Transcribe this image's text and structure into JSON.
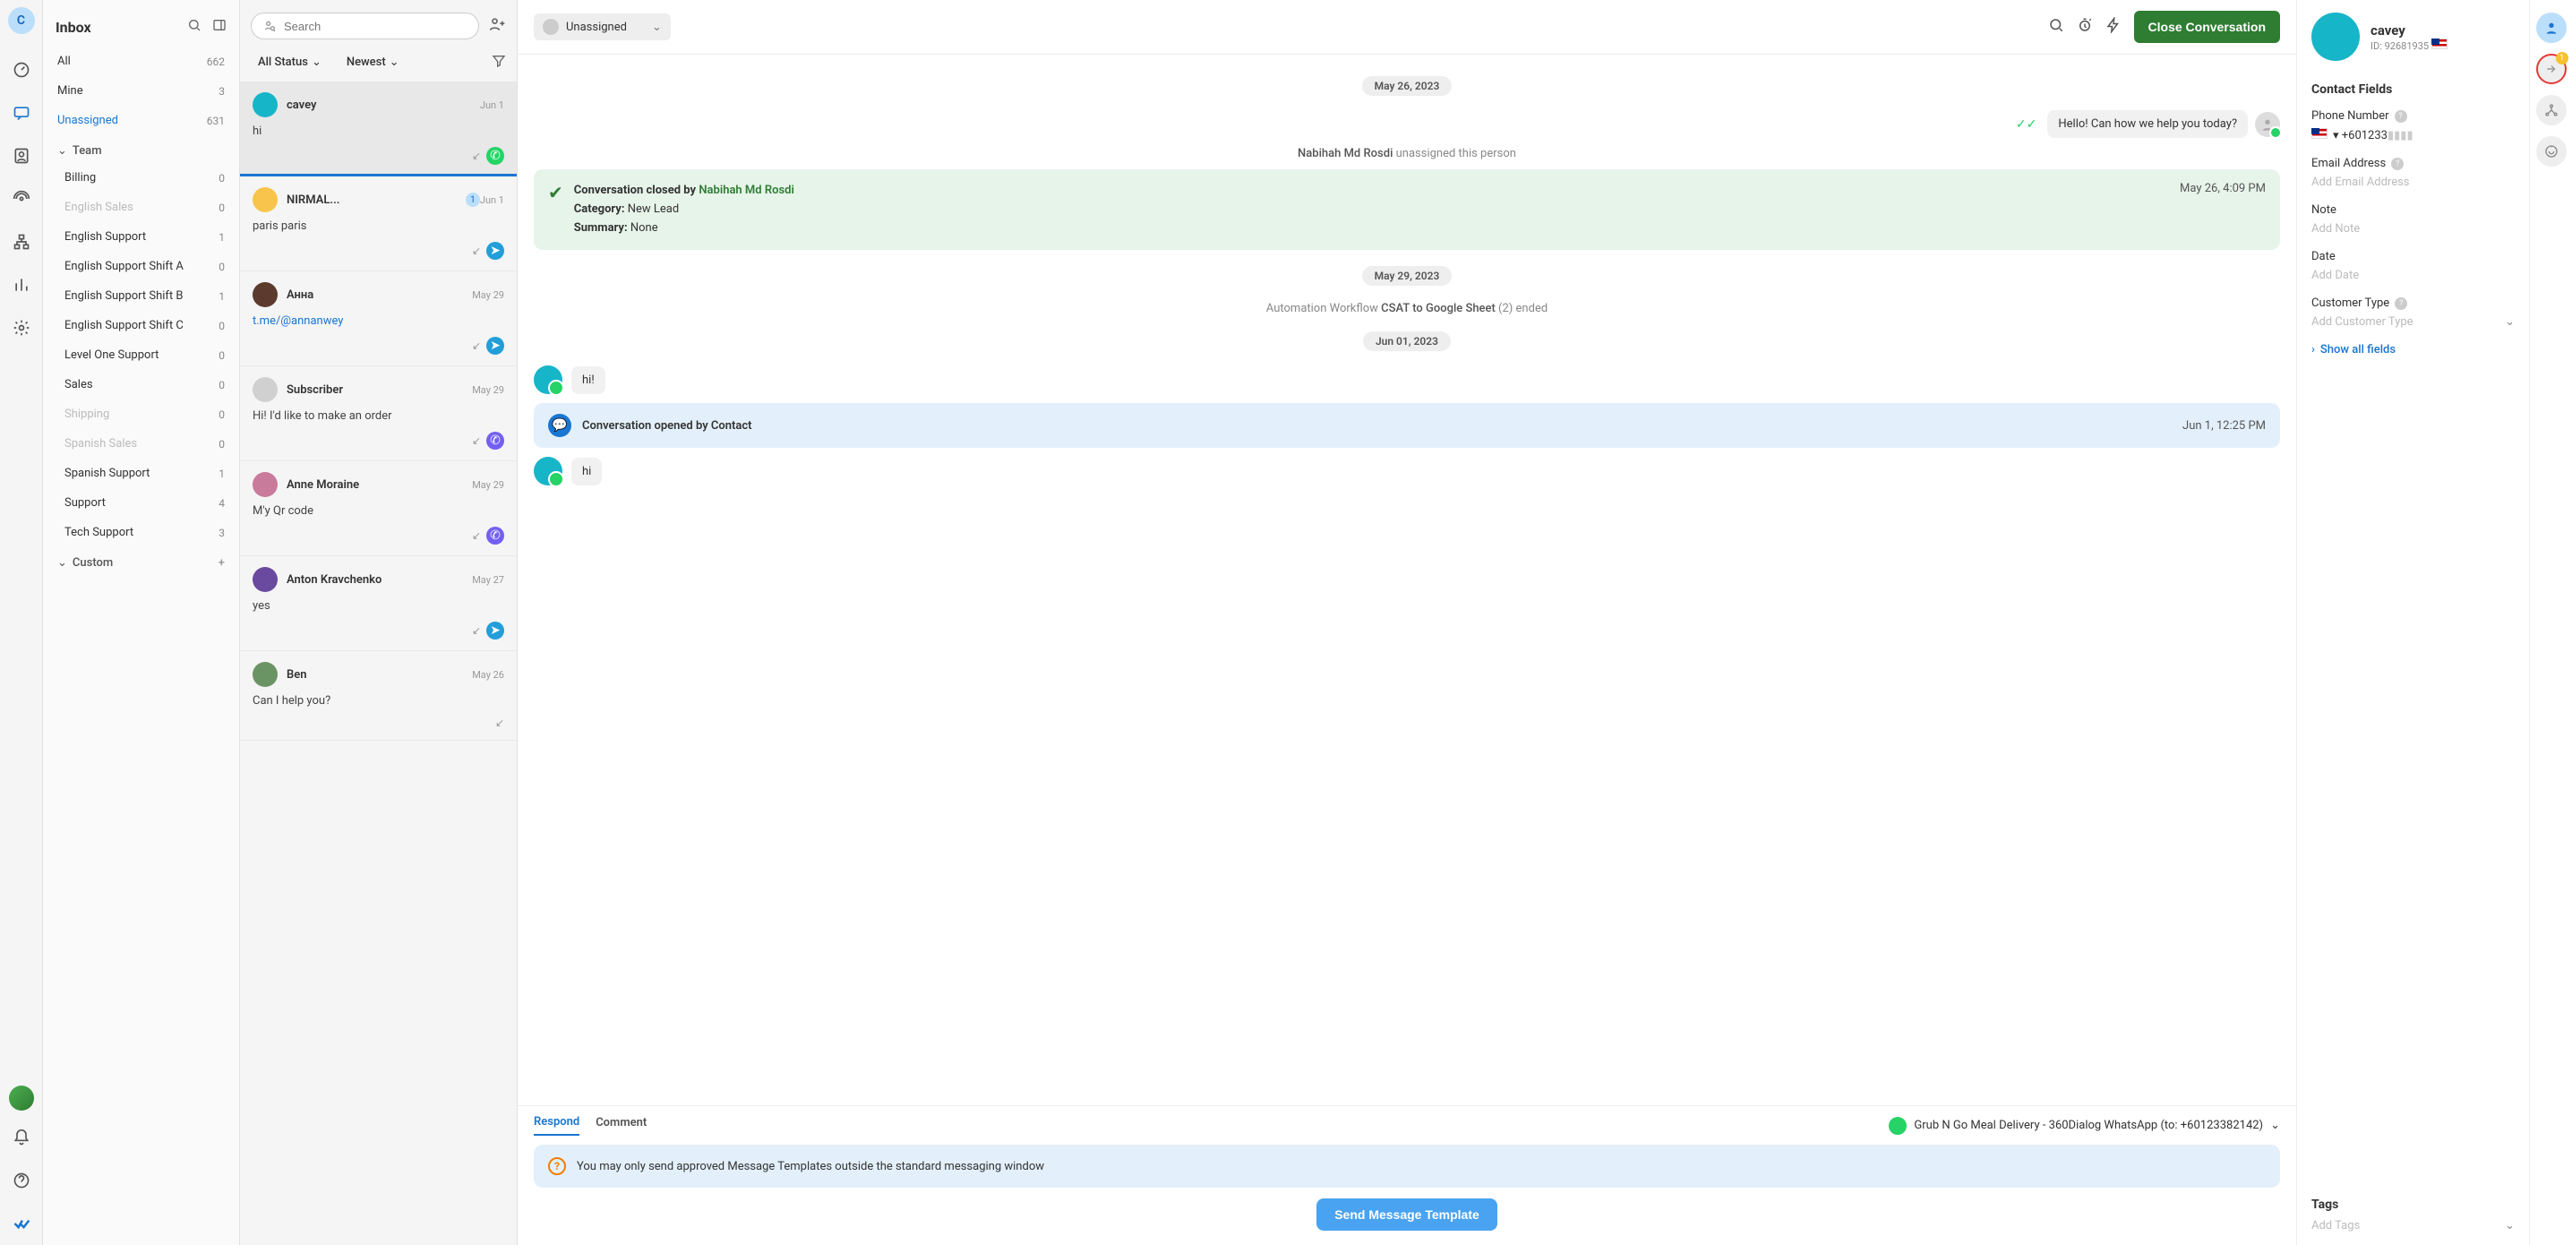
{
  "rail": {
    "avatar_letter": "C"
  },
  "sidebar": {
    "title": "Inbox",
    "items": [
      {
        "label": "All",
        "count": "662",
        "key": "all"
      },
      {
        "label": "Mine",
        "count": "3",
        "key": "mine"
      },
      {
        "label": "Unassigned",
        "count": "631",
        "key": "unassigned",
        "active": true
      }
    ],
    "team_label": "Team",
    "team_items": [
      {
        "label": "Billing",
        "count": "0"
      },
      {
        "label": "English Sales",
        "count": "0",
        "muted": true
      },
      {
        "label": "English Support",
        "count": "1"
      },
      {
        "label": "English Support Shift A",
        "count": "0"
      },
      {
        "label": "English Support Shift B",
        "count": "1"
      },
      {
        "label": "English Support Shift C",
        "count": "0"
      },
      {
        "label": "Level One Support",
        "count": "0"
      },
      {
        "label": "Sales",
        "count": "0"
      },
      {
        "label": "Shipping",
        "count": "0",
        "muted": true
      },
      {
        "label": "Spanish Sales",
        "count": "0",
        "muted": true
      },
      {
        "label": "Spanish Support",
        "count": "1"
      },
      {
        "label": "Support",
        "count": "4"
      },
      {
        "label": "Tech Support",
        "count": "3"
      }
    ],
    "custom_label": "Custom"
  },
  "convlist": {
    "search_placeholder": "Search",
    "filter_status": "All Status",
    "filter_sort": "Newest",
    "items": [
      {
        "name": "cavey",
        "time": "Jun 1",
        "preview": "hi",
        "channel": "whatsapp",
        "selected": true,
        "avatar_bg": "#17b5c8"
      },
      {
        "name": "NIRMAL...",
        "badge": "1",
        "time": "Jun 1",
        "preview": "paris paris",
        "channel": "telegram",
        "avatar_bg": "#f8c44b"
      },
      {
        "name": "Анна",
        "time": "May 29",
        "preview": "t.me/@annanwey",
        "channel": "telegram",
        "avatar_bg": "#5c3a2e",
        "preview_link": true
      },
      {
        "name": "Subscriber",
        "time": "May 29",
        "preview": "Hi! I'd like to make an order",
        "channel": "viber",
        "avatar_bg": "#d0d0d0"
      },
      {
        "name": "Anne Moraine",
        "time": "May 29",
        "preview": "M'y Qr code",
        "channel": "viber",
        "avatar_bg": "#c97b9c"
      },
      {
        "name": "Anton Kravchenko",
        "time": "May 27",
        "preview": "yes",
        "channel": "telegram",
        "avatar_bg": "#6a4a9e"
      },
      {
        "name": "Ben",
        "time": "May 26",
        "preview": "Can I help you?",
        "channel": "",
        "avatar_bg": "#6b9464"
      }
    ]
  },
  "conv": {
    "assignee": "Unassigned",
    "close_label": "Close Conversation",
    "dates": {
      "d1": "May 26, 2023",
      "d2": "May 29, 2023",
      "d3": "Jun 01, 2023"
    },
    "out1": "Hello! Can how we help you today?",
    "sys_unassign_prefix": "Nabihah Md Rosdi",
    "sys_unassign_suffix": " unassigned this person",
    "closed": {
      "prefix": "Conversation closed by ",
      "by": "Nabihah Md Rosdi",
      "cat_label": "Category:",
      "cat_val": " New Lead",
      "sum_label": "Summary:",
      "sum_val": " None",
      "time": "May 26, 4:09 PM"
    },
    "workflow_prefix": "Automation Workflow ",
    "workflow_name": "CSAT to Google Sheet",
    "workflow_suffix": " (2) ended",
    "in1": "hi!",
    "opened": {
      "text": "Conversation opened by Contact",
      "time": "Jun 1, 12:25 PM"
    },
    "in2": "hi",
    "footer": {
      "tab_respond": "Respond",
      "tab_comment": "Comment",
      "channel": "Grub N Go Meal Delivery - 360Dialog WhatsApp (to: +60123382142)",
      "warning": "You may only send approved Message Templates outside the standard messaging window",
      "send_btn": "Send Message Template"
    }
  },
  "details": {
    "name": "cavey",
    "id_label": "ID: 92681935",
    "section_title": "Contact Fields",
    "phone_label": "Phone Number",
    "phone_val": "+601233",
    "email_label": "Email Address",
    "email_ph": "Add Email Address",
    "note_label": "Note",
    "note_ph": "Add Note",
    "date_label": "Date",
    "date_ph": "Add Date",
    "ctype_label": "Customer Type",
    "ctype_ph": "Add Customer Type",
    "showall": "Show all fields",
    "tags_title": "Tags",
    "tags_ph": "Add Tags"
  },
  "rrail": {
    "badge": "1"
  }
}
